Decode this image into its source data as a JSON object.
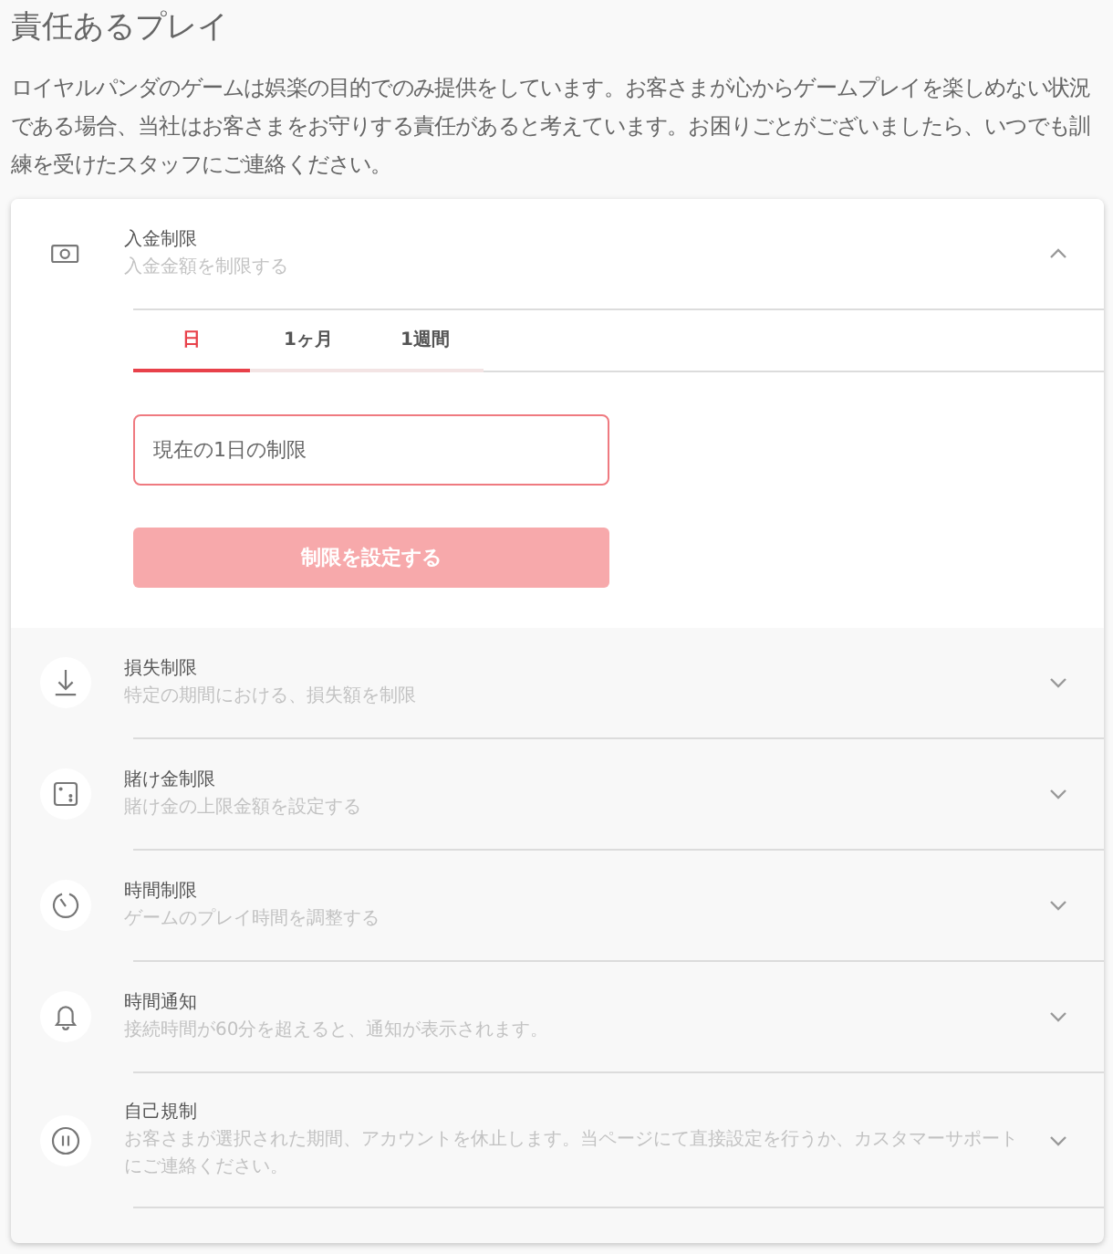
{
  "page": {
    "title": "責任あるプレイ",
    "intro": "ロイヤルパンダのゲームは娯楽の目的でのみ提供をしています。お客さまが心からゲームプレイを楽しめない状況である場合、当社はお客さまをお守りする責任があると考えています。お困りごとがございましたら、いつでも訓練を受けたスタッフにご連絡ください。"
  },
  "limits": [
    {
      "title": "入金制限",
      "subtitle": "入金金額を制限する",
      "expanded": true,
      "tabs": [
        {
          "label": "日",
          "selected": true
        },
        {
          "label": "1ヶ月",
          "selected": false
        },
        {
          "label": "1週間",
          "selected": false
        }
      ],
      "amount_field": {
        "placeholder": "現在の1日の制限"
      },
      "submit_button": {
        "label": "制限を設定する",
        "disabled": true
      }
    },
    {
      "title": "損失制限",
      "subtitle": "特定の期間における、損失額を制限",
      "expanded": false
    },
    {
      "title": "賭け金制限",
      "subtitle": "賭け金の上限金額を設定する",
      "expanded": false
    },
    {
      "title": "時間制限",
      "subtitle": "ゲームのプレイ時間を調整する",
      "expanded": false
    },
    {
      "title": "時間通知",
      "subtitle": "接続時間が60分を超えると、通知が表示されます。",
      "expanded": false
    },
    {
      "title": "自己規制",
      "subtitle": "お客さまが選択された期間、アカウントを休止します。当ページにて直接設定を行うか、カスタマーサポートにご連絡ください。",
      "expanded": false
    }
  ]
}
